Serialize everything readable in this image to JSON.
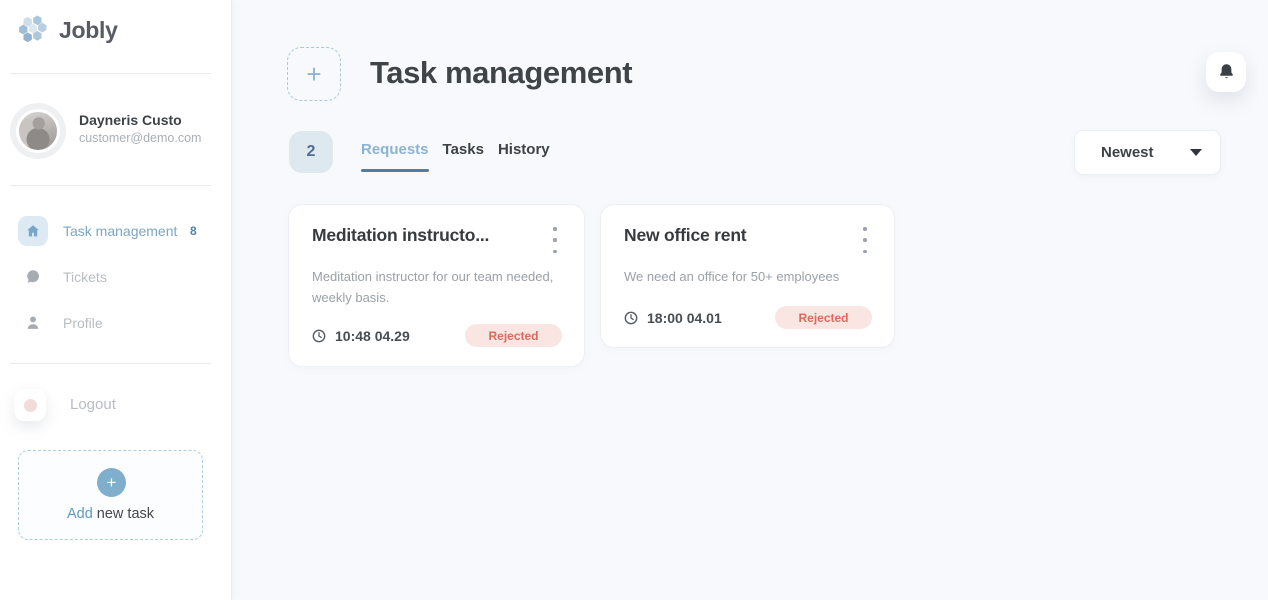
{
  "icons": {
    "plus": "+"
  },
  "colors": {
    "accent": "#79a7c9",
    "accent_dark": "#527ea1",
    "danger": "#dd695d",
    "danger_bg": "#f9e6e3",
    "sidebar_bg": "#ffffff",
    "main_bg": "#f7f9fc"
  },
  "sidebar": {
    "logo_text": "Jobly",
    "user": {
      "name": "Dayneris Custo",
      "email": "customer@demo.com"
    },
    "nav": [
      {
        "label": "Task management",
        "badge": "8",
        "icon": "home-icon",
        "active": true
      },
      {
        "label": "Tickets",
        "icon": "chat-icon",
        "active": false
      },
      {
        "label": "Profile",
        "icon": "person-icon",
        "active": false
      }
    ],
    "logout_label": "Logout",
    "add_task": {
      "action": "Add",
      "rest": "new task"
    }
  },
  "header": {
    "title": "Task management"
  },
  "tabs": {
    "count_badge": "2",
    "items": [
      {
        "label": "Requests",
        "active": true
      },
      {
        "label": "Tasks",
        "active": false
      },
      {
        "label": "History",
        "active": false
      }
    ]
  },
  "sort": {
    "selected": "Newest"
  },
  "cards": [
    {
      "title": "Meditation instructo...",
      "description": "Meditation instructor for our team needed, weekly basis.",
      "time": "10:48 04.29",
      "status": "Rejected"
    },
    {
      "title": "New office rent",
      "description": "We need an office for 50+ employees",
      "time": "18:00 04.01",
      "status": "Rejected"
    }
  ]
}
